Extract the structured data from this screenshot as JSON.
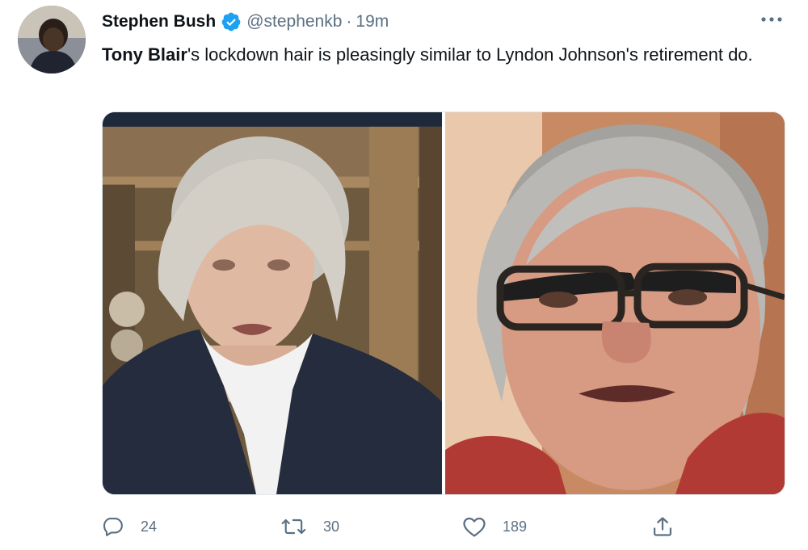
{
  "author": {
    "display_name": "Stephen Bush",
    "handle": "@stephenkb",
    "separator": "·",
    "time": "19m",
    "verified": true
  },
  "tweet": {
    "bold_part": "Tony Blair",
    "rest": "'s lockdown hair is pleasingly similar to Lyndon Johnson's retirement do."
  },
  "media": {
    "images": [
      {
        "icon": "photo-tony-blair"
      },
      {
        "icon": "photo-lyndon-johnson"
      }
    ]
  },
  "actions": {
    "reply_count": "24",
    "retweet_count": "30",
    "like_count": "189"
  },
  "colors": {
    "verified_blue": "#1da1f2",
    "secondary_text": "#5b7083"
  }
}
